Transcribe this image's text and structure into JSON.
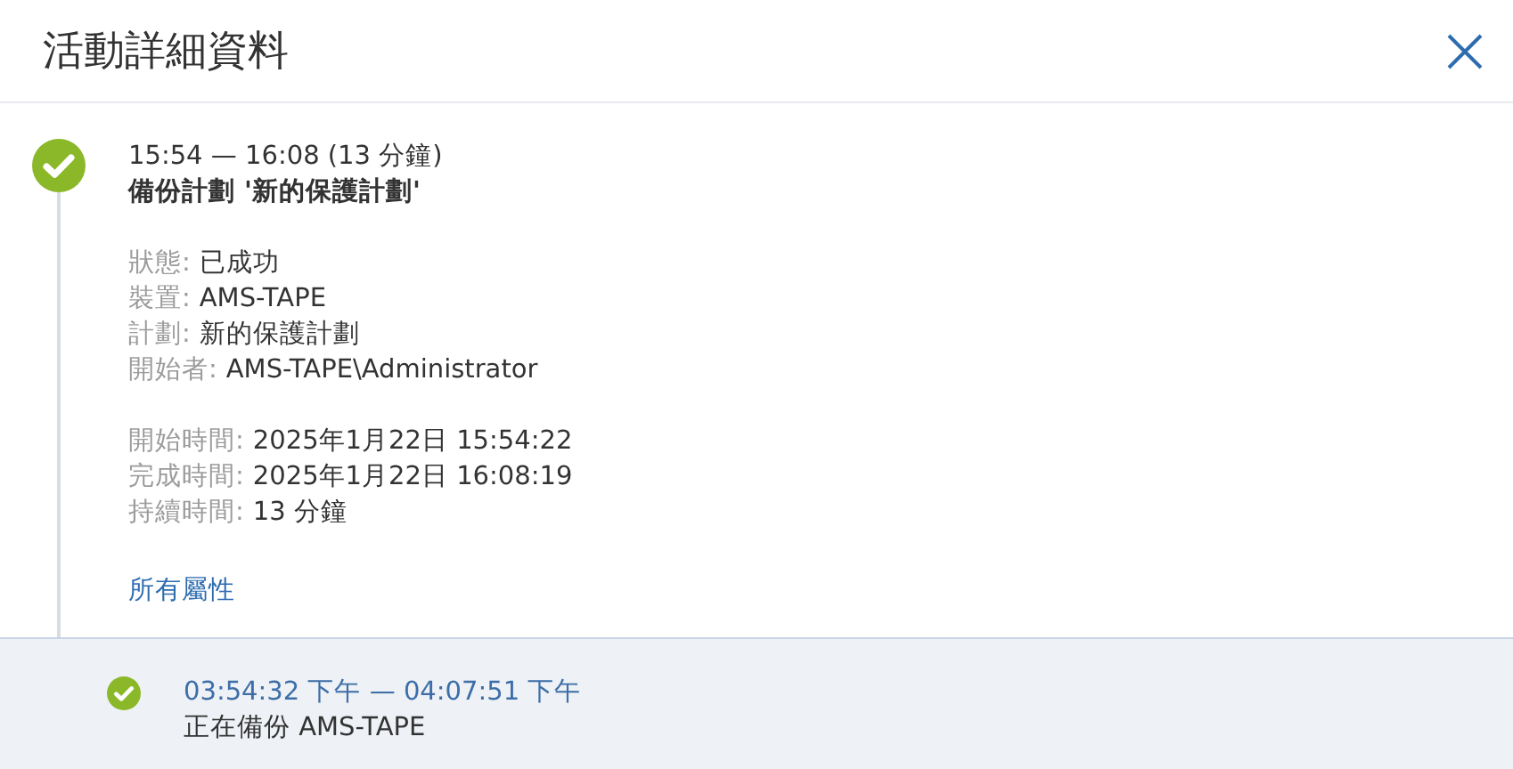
{
  "title": "活動詳細資料",
  "activity": {
    "time_range": "15:54 — 16:08 (13 分鐘)",
    "name": "備份計劃 '新的保護計劃'",
    "detail_groups": [
      [
        {
          "label": "狀態:",
          "value": "已成功"
        },
        {
          "label": "裝置:",
          "value": "AMS-TAPE"
        },
        {
          "label": "計劃:",
          "value": "新的保護計劃"
        },
        {
          "label": "開始者:",
          "value": "AMS-TAPE\\Administrator"
        }
      ],
      [
        {
          "label": "開始時間:",
          "value": "2025年1月22日 15:54:22"
        },
        {
          "label": "完成時間:",
          "value": "2025年1月22日 16:08:19"
        },
        {
          "label": "持續時間:",
          "value": "13 分鐘"
        }
      ]
    ],
    "link": "所有屬性"
  },
  "sub_activities": [
    {
      "time_range": "03:54:32 下午 — 04:07:51 下午",
      "description": "正在備份 AMS-TAPE"
    }
  ]
}
